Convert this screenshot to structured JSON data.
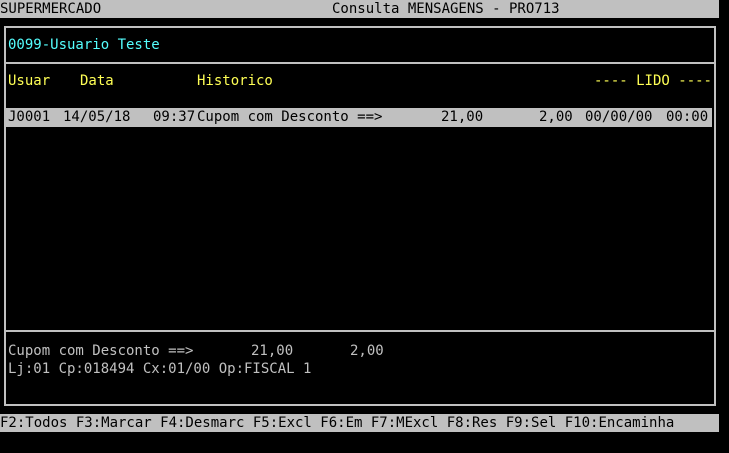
{
  "header": {
    "company": "SUPERMERCADO",
    "title": "Consulta MENSAGENS - PRO713"
  },
  "user": "0099-Usuario Teste",
  "columns": {
    "usuar": "Usuar",
    "data": "Data",
    "historico": "Historico",
    "lido": "---- LIDO ----"
  },
  "rows": [
    {
      "user": "J0001",
      "date": "14/05/18",
      "time": "09:37",
      "historico": "Cupom com Desconto ==>",
      "value1": "21,00",
      "value2": "2,00",
      "lido_date": "00/00/00",
      "lido_time": "00:00"
    }
  ],
  "detail": {
    "historico": "Cupom com Desconto ==>",
    "value1": "21,00",
    "value2": "2,00",
    "info": "Lj:01 Cp:018494 Cx:01/00 Op:FISCAL 1"
  },
  "function_keys": "F2:Todos F3:Marcar F4:Desmarc F5:Excl F6:Em F7:MExcl F8:Res F9:Sel F10:Encaminha",
  "colors": {
    "background": "#000000",
    "bar": "#c0c0c0",
    "user_title": "#55ffff",
    "column_headers": "#ffff55",
    "text": "#c0c0c0"
  }
}
